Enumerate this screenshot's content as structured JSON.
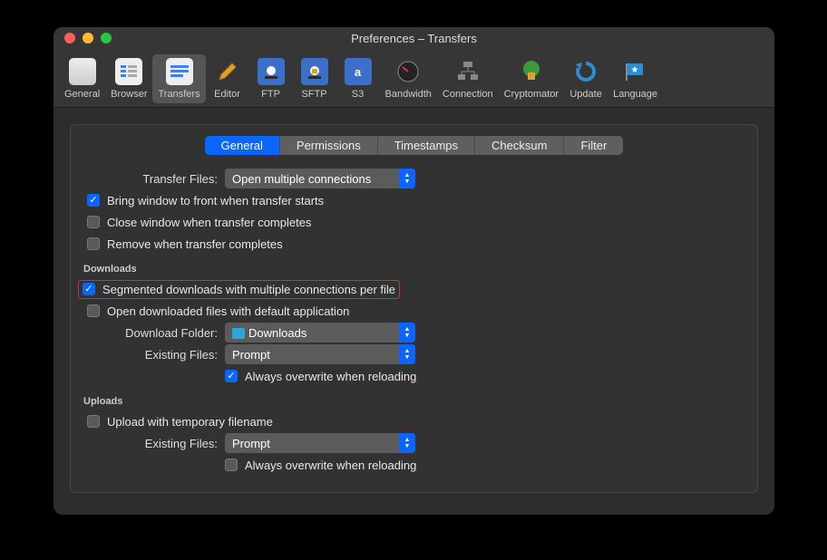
{
  "window": {
    "title": "Preferences – Transfers"
  },
  "toolbar": [
    {
      "label": "General"
    },
    {
      "label": "Browser"
    },
    {
      "label": "Transfers"
    },
    {
      "label": "Editor"
    },
    {
      "label": "FTP"
    },
    {
      "label": "SFTP"
    },
    {
      "label": "S3"
    },
    {
      "label": "Bandwidth"
    },
    {
      "label": "Connection"
    },
    {
      "label": "Cryptomator"
    },
    {
      "label": "Update"
    },
    {
      "label": "Language"
    }
  ],
  "tabs": [
    "General",
    "Permissions",
    "Timestamps",
    "Checksum",
    "Filter"
  ],
  "labels": {
    "transferFiles": "Transfer Files:",
    "downloadFolder": "Download Folder:",
    "existingFiles": "Existing Files:"
  },
  "sections": {
    "downloads": "Downloads",
    "uploads": "Uploads"
  },
  "selects": {
    "transferFiles": "Open multiple connections",
    "downloadFolder": "Downloads",
    "existingFilesDown": "Prompt",
    "existingFilesUp": "Prompt"
  },
  "checks": {
    "bringFront": "Bring window to front when transfer starts",
    "closeComplete": "Close window when transfer completes",
    "removeComplete": "Remove when transfer completes",
    "segmented": "Segmented downloads with multiple connections per file",
    "openDefault": "Open downloaded files with default application",
    "alwaysOverwriteDown": "Always overwrite when reloading",
    "uploadTemp": "Upload with temporary filename",
    "alwaysOverwriteUp": "Always overwrite when reloading"
  }
}
